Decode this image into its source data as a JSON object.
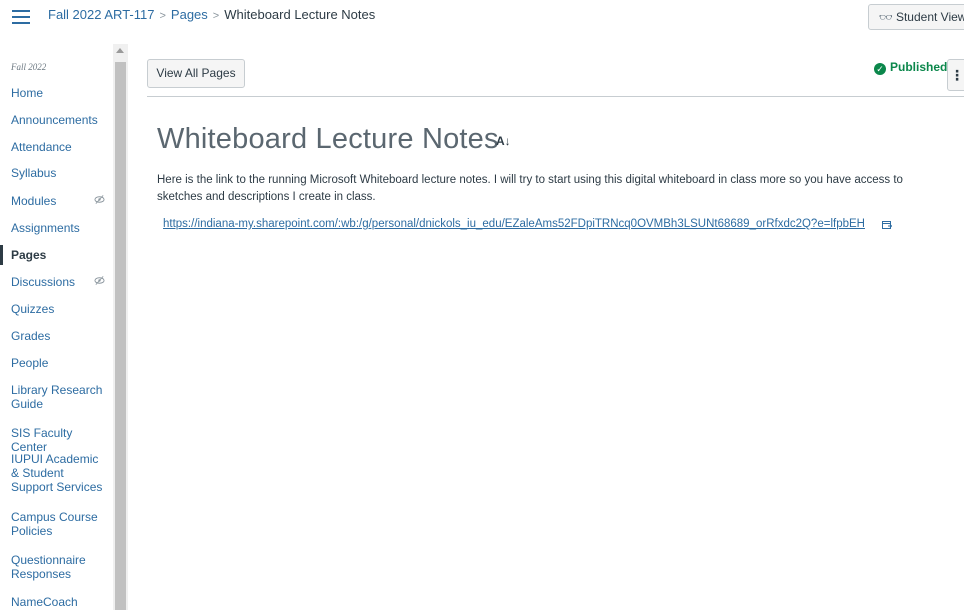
{
  "header": {
    "breadcrumb": {
      "course": "Fall 2022 ART-117",
      "section": "Pages",
      "current": "Whiteboard Lecture Notes"
    },
    "student_view_label": "Student View",
    "student_view_icon": "glasses-icon"
  },
  "sidebar": {
    "term": "Fall 2022",
    "items": [
      {
        "label": "Home"
      },
      {
        "label": "Announcements"
      },
      {
        "label": "Attendance"
      },
      {
        "label": "Syllabus"
      },
      {
        "label": "Modules",
        "hidden": true
      },
      {
        "label": "Assignments"
      },
      {
        "label": "Pages",
        "active": true
      },
      {
        "label": "Discussions",
        "hidden": true
      },
      {
        "label": "Quizzes"
      },
      {
        "label": "Grades"
      },
      {
        "label": "People"
      },
      {
        "label": "Library Research Guide"
      },
      {
        "label": "SIS Faculty Center"
      },
      {
        "label": "IUPUI Academic & Student Support Services"
      },
      {
        "label": "Campus Course Policies"
      },
      {
        "label": "Questionnaire Responses"
      },
      {
        "label": "NameCoach"
      }
    ]
  },
  "toolbar": {
    "view_all_label": "View All Pages",
    "status_label": "Published",
    "more_label": "⋮"
  },
  "page": {
    "title": "Whiteboard Lecture Notes",
    "body": "Here is the link to the running Microsoft Whiteboard lecture notes. I will try to start using this digital whiteboard in class more so you have access to sketches and descriptions I create in class.",
    "link": "https://indiana-my.sharepoint.com/:wb:/g/personal/dnickols_iu_edu/EZaleAms52FDpiTRNcq0OVMBh3LSUNt68689_orRfxdc2Q?e=lfpbEH"
  },
  "colors": {
    "link": "#2d6ca2",
    "text": "#2d3b45",
    "published": "#0b874b"
  }
}
